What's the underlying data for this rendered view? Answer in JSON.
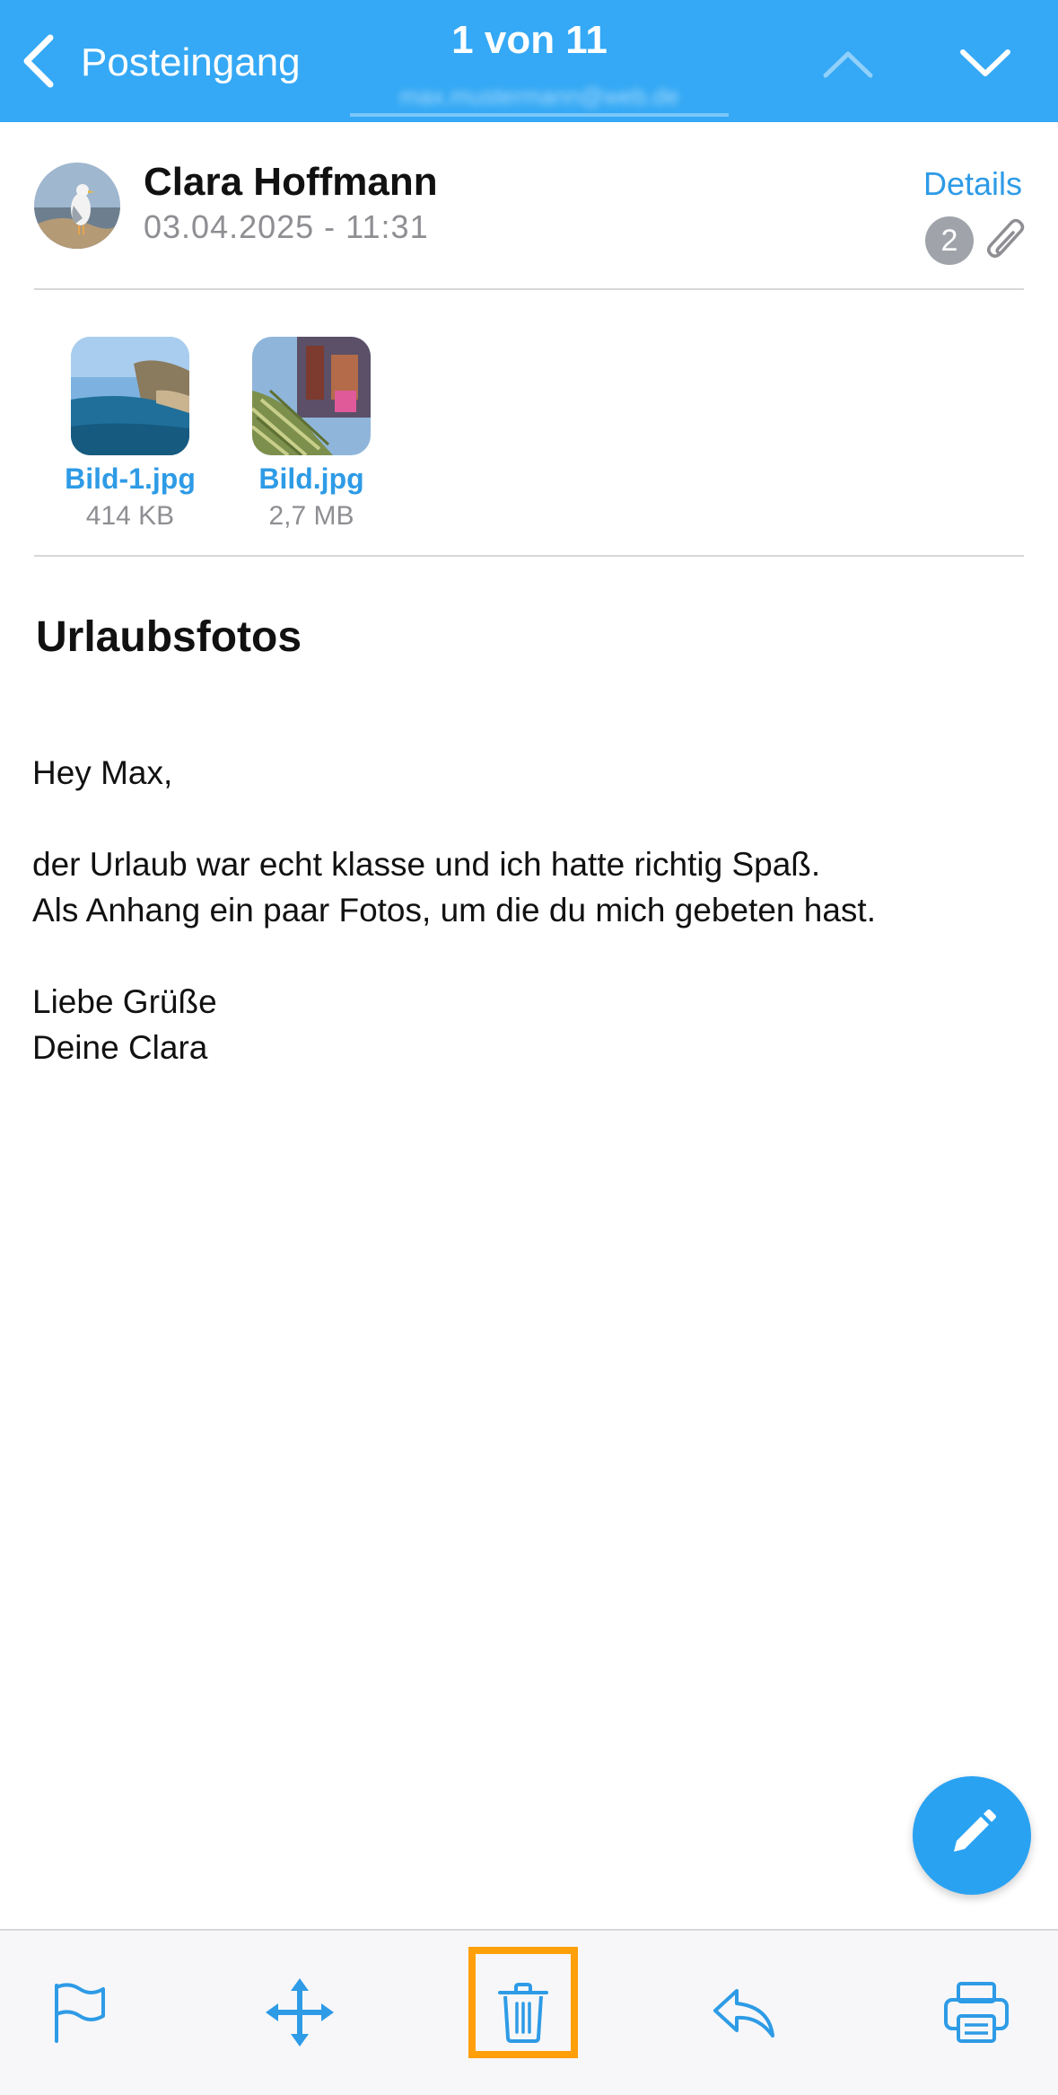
{
  "header": {
    "back_label": "Posteingang",
    "counter": "1 von 11",
    "account_obscured": "max.mustermann@web.de"
  },
  "sender": {
    "name": "Clara Hoffmann",
    "date": "03.04.2025 - 11:31",
    "details_label": "Details",
    "attachment_count": "2"
  },
  "attachments": [
    {
      "name": "Bild-1.jpg",
      "size": "414 KB"
    },
    {
      "name": "Bild.jpg",
      "size": "2,7 MB"
    }
  ],
  "message": {
    "subject": "Urlaubsfotos",
    "lines": [
      "Hey Max,",
      "der Urlaub war echt klasse und ich hatte richtig Spaß.",
      "Als Anhang ein paar Fotos, um die du mich gebeten hast.",
      "Liebe Grüße",
      "Deine Clara"
    ]
  },
  "toolbar": {
    "icons": [
      "flag-icon",
      "move-icon",
      "trash-icon",
      "reply-icon",
      "print-icon"
    ],
    "highlighted": "trash-icon"
  },
  "colors": {
    "header_bg": "#35a9f5",
    "accent": "#2e9be6",
    "highlight": "#ff9f0a"
  }
}
